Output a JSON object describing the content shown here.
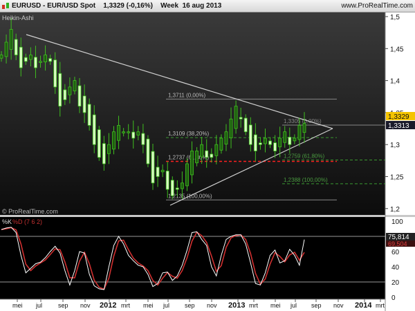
{
  "header": {
    "title": "EURUSD - EUR/USD Spot",
    "price": "1,3329 (-0,16%)",
    "period": "Week  16 aug 2013",
    "site": "www.ProRealTime.com",
    "logo_icon": "candlestick-icon"
  },
  "price_panel": {
    "label": "Heikin-Ashi",
    "watermark": "© ProRealTime.com",
    "axis_ticks": [
      "1,5",
      "1,45",
      "1,4",
      "1,35",
      "1,3",
      "1,25",
      "1,2"
    ],
    "last_price": "1,3329",
    "last_price_color": "#f5c400",
    "second_price": "1,3313",
    "fib1": [
      {
        "label": "1,3711 (0,00%)",
        "value": 1.3711,
        "style": "gray"
      },
      {
        "label": "1,3109 (38,20%)",
        "value": 1.3109,
        "style": "green-dashed"
      },
      {
        "label": "1,2737 (61,80%)",
        "value": 1.2737,
        "style": "red-dashed"
      },
      {
        "label": "1,2135 (100,00%)",
        "value": 1.2135,
        "style": "gray"
      }
    ],
    "fib2": [
      {
        "label": "1,3305 (0,00%)",
        "value": 1.3305,
        "style": "gray"
      },
      {
        "label": "1,2759 (61,80%)",
        "value": 1.2759,
        "style": "green-dashed"
      },
      {
        "label": "1,2388 (100,00%)",
        "value": 1.2388,
        "style": "green-dashed"
      }
    ]
  },
  "stoch_panel": {
    "label_k": "%K",
    "label_d": "%D (7 6 2)",
    "axis_ticks": [
      "100",
      "80",
      "60",
      "40",
      "20",
      "0"
    ],
    "last_k": "75,814",
    "last_d": "69,504"
  },
  "date_axis": [
    "mei",
    "jul",
    "sep",
    "nov",
    "2012",
    "mrt",
    "mei",
    "jul",
    "sep",
    "nov",
    "2013",
    "mrt",
    "mei",
    "jul",
    "sep",
    "nov",
    "2014",
    "mrt"
  ],
  "chart_data": {
    "type": "candlestick",
    "x_start": "2011-04-08",
    "x_end": "2013-08-16",
    "interval": "2 weeks",
    "close": [
      1.44,
      1.46,
      1.48,
      1.44,
      1.42,
      1.43,
      1.44,
      1.42,
      1.43,
      1.44,
      1.43,
      1.39,
      1.36,
      1.37,
      1.39,
      1.4,
      1.36,
      1.35,
      1.33,
      1.3,
      1.28,
      1.27,
      1.3,
      1.32,
      1.33,
      1.32,
      1.32,
      1.31,
      1.32,
      1.3,
      1.27,
      1.24,
      1.25,
      1.26,
      1.23,
      1.22,
      1.23,
      1.24,
      1.27,
      1.29,
      1.29,
      1.3,
      1.28,
      1.28,
      1.3,
      1.31,
      1.32,
      1.34,
      1.36,
      1.34,
      1.32,
      1.3,
      1.29,
      1.3,
      1.31,
      1.3,
      1.29,
      1.31,
      1.32,
      1.3,
      1.31,
      1.33,
      1.3329
    ],
    "stoch_k": [
      89,
      91,
      92,
      85,
      55,
      32,
      38,
      44,
      46,
      52,
      60,
      67,
      58,
      35,
      16,
      35,
      60,
      58,
      30,
      15,
      11,
      10,
      40,
      68,
      80,
      70,
      55,
      48,
      42,
      40,
      30,
      14,
      18,
      32,
      33,
      22,
      28,
      42,
      62,
      85,
      86,
      76,
      68,
      40,
      28,
      55,
      76,
      80,
      82,
      82,
      70,
      45,
      18,
      16,
      32,
      55,
      62,
      45,
      48,
      63,
      55,
      42,
      75.8
    ],
    "ylim": [
      1.19,
      1.51
    ],
    "stoch_ylim": [
      -5,
      105
    ],
    "colors": {
      "bull": "#3fbf1f",
      "bear_body": "#d8ffc0",
      "trendline": "#d0d0d0",
      "k": "#ffffff",
      "d": "#d03030"
    }
  }
}
